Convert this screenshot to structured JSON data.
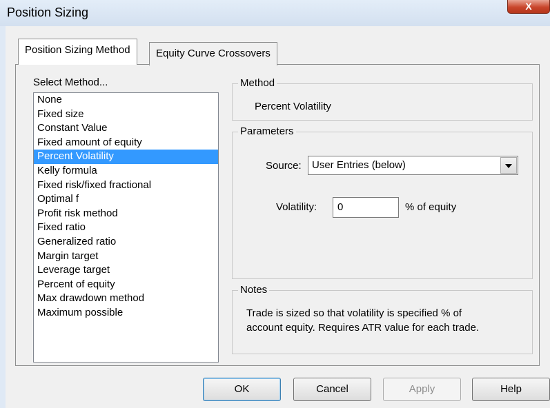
{
  "window": {
    "title": "Position Sizing",
    "close_glyph": "X"
  },
  "tabs": [
    {
      "label": "Position Sizing Method",
      "active": true
    },
    {
      "label": "Equity Curve Crossovers",
      "active": false
    }
  ],
  "method_list": {
    "label": "Select Method...",
    "items": [
      "None",
      "Fixed size",
      "Constant Value",
      "Fixed amount of equity",
      "Percent Volatility",
      "Kelly formula",
      "Fixed risk/fixed fractional",
      "Optimal f",
      "Profit risk method",
      "Fixed ratio",
      "Generalized ratio",
      "Margin target",
      "Leverage target",
      "Percent of equity",
      "Max drawdown method",
      "Maximum possible"
    ],
    "selected": "Percent Volatility"
  },
  "method_group": {
    "legend": "Method",
    "value": "Percent Volatility"
  },
  "parameters_group": {
    "legend": "Parameters",
    "source_label": "Source:",
    "source_value": "User Entries (below)",
    "volatility_label": "Volatility:",
    "volatility_value": "0",
    "volatility_unit": "% of equity"
  },
  "notes_group": {
    "legend": "Notes",
    "line1": "Trade is sized so that volatility is specified % of",
    "line2": "account equity. Requires ATR value for each trade."
  },
  "buttons": {
    "ok": "OK",
    "cancel": "Cancel",
    "apply": "Apply",
    "help": "Help"
  },
  "colors": {
    "selection": "#3399ff",
    "close_button": "#c9462c"
  }
}
